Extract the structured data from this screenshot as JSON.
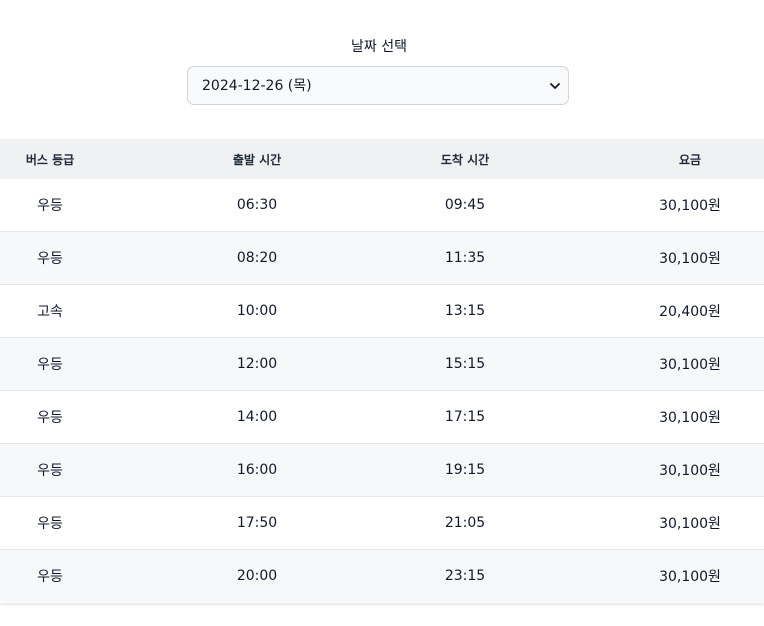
{
  "date_picker": {
    "label": "날짜 선택",
    "selected": "2024-12-26 (목)"
  },
  "table": {
    "headers": [
      "버스 등급",
      "출발 시간",
      "도착 시간",
      "요금"
    ],
    "rows": [
      {
        "grade": "우등",
        "depart": "06:30",
        "arrive": "09:45",
        "fare": "30,100원"
      },
      {
        "grade": "우등",
        "depart": "08:20",
        "arrive": "11:35",
        "fare": "30,100원"
      },
      {
        "grade": "고속",
        "depart": "10:00",
        "arrive": "13:15",
        "fare": "20,400원"
      },
      {
        "grade": "우등",
        "depart": "12:00",
        "arrive": "15:15",
        "fare": "30,100원"
      },
      {
        "grade": "우등",
        "depart": "14:00",
        "arrive": "17:15",
        "fare": "30,100원"
      },
      {
        "grade": "우등",
        "depart": "16:00",
        "arrive": "19:15",
        "fare": "30,100원"
      },
      {
        "grade": "우등",
        "depart": "17:50",
        "arrive": "21:05",
        "fare": "30,100원"
      },
      {
        "grade": "우등",
        "depart": "20:00",
        "arrive": "23:15",
        "fare": "30,100원"
      }
    ]
  },
  "colors": {
    "header_bg": "#f0f1f3",
    "stripe_bg": "#f7f8fa",
    "border": "#e5e7eb"
  }
}
